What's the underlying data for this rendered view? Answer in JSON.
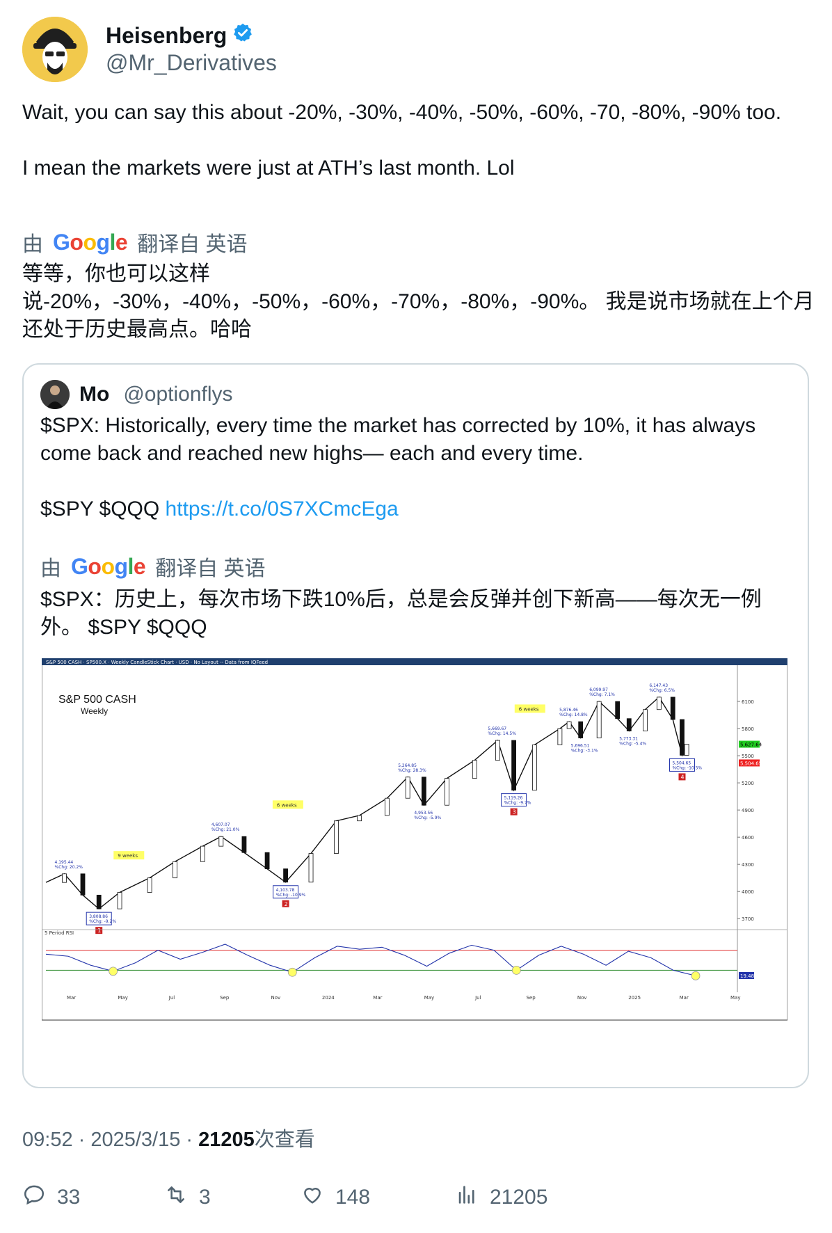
{
  "author": {
    "display_name": "Heisenberg",
    "handle": "@Mr_Derivatives"
  },
  "tweet": {
    "line1": "Wait, you can say this about -20%, -30%, -40%, -50%, -60%, -70, -80%, -90% too.",
    "line2": "I mean the markets were just at ATH’s last month. Lol",
    "translate_prefix": "由",
    "translate_suffix": "翻译自 英语",
    "translated_line1": "等等，你也可以这样",
    "translated_line2": "说-20%，-30%，-40%，-50%，-60%，-70%，-80%，-90%。 我是说市场就在上个月还处于历史最高点。哈哈"
  },
  "quote": {
    "display_name": "Mo",
    "handle": "@optionflys",
    "text": "$SPX: Historically, every time the market has corrected by 10%, it has always come back and reached new highs— each and every time.",
    "tickers": "$SPY $QQQ",
    "link": "https://t.co/0S7XCmcEga",
    "translate_prefix": "由",
    "translate_suffix": "翻译自 英语",
    "translated": "$SPX：历史上，每次市场下跌10%后，总是会反弹并创下新高——每次无一例外。 $SPY $QQQ"
  },
  "chart_data": {
    "type": "line",
    "header": "S&P 500 CASH · SP500.X · Weekly CandleStick Chart · USD · No Layout -- Data from IQFeed",
    "title": "S&P 500 CASH",
    "subtitle": "Weekly",
    "x_labels": [
      "Mar",
      "May",
      "Jul",
      "Sep",
      "Nov",
      "2024",
      "Mar",
      "May",
      "Jul",
      "Sep",
      "Nov",
      "2025",
      "Mar",
      "May"
    ],
    "y_ticks": [
      3700,
      4000,
      4300,
      4600,
      4900,
      5200,
      5500,
      5800,
      6100
    ],
    "ylim": [
      3640,
      6300
    ],
    "price_series": [
      {
        "x": 0,
        "y": 4100
      },
      {
        "x": 0.8,
        "y": 4195
      },
      {
        "x": 1.6,
        "y": 3960
      },
      {
        "x": 2.3,
        "y": 3808
      },
      {
        "x": 3.2,
        "y": 3990
      },
      {
        "x": 4.5,
        "y": 4150
      },
      {
        "x": 5.6,
        "y": 4330
      },
      {
        "x": 6.8,
        "y": 4500
      },
      {
        "x": 7.6,
        "y": 4607
      },
      {
        "x": 8.6,
        "y": 4430
      },
      {
        "x": 9.6,
        "y": 4250
      },
      {
        "x": 10.4,
        "y": 4103
      },
      {
        "x": 11.5,
        "y": 4420
      },
      {
        "x": 12.6,
        "y": 4780
      },
      {
        "x": 13.6,
        "y": 4840
      },
      {
        "x": 14.8,
        "y": 5030
      },
      {
        "x": 15.7,
        "y": 5264
      },
      {
        "x": 16.4,
        "y": 4953
      },
      {
        "x": 17.4,
        "y": 5250
      },
      {
        "x": 18.6,
        "y": 5450
      },
      {
        "x": 19.6,
        "y": 5669
      },
      {
        "x": 20.3,
        "y": 5119
      },
      {
        "x": 21.2,
        "y": 5620
      },
      {
        "x": 22.3,
        "y": 5800
      },
      {
        "x": 22.7,
        "y": 5876
      },
      {
        "x": 23.2,
        "y": 5696
      },
      {
        "x": 24.0,
        "y": 6099
      },
      {
        "x": 24.8,
        "y": 5910
      },
      {
        "x": 25.3,
        "y": 5773
      },
      {
        "x": 26.0,
        "y": 6010
      },
      {
        "x": 26.6,
        "y": 6147
      },
      {
        "x": 27.2,
        "y": 5900
      },
      {
        "x": 27.6,
        "y": 5505
      },
      {
        "x": 27.8,
        "y": 5627
      }
    ],
    "annotations": [
      {
        "x": 0.8,
        "y": 4195,
        "label": "4,195.44",
        "change": "%Chg: 20.2%"
      },
      {
        "x": 2.3,
        "y": 3808,
        "label": "3,808.86",
        "change": "%Chg: -9.2%",
        "num": "1"
      },
      {
        "x": 7.6,
        "y": 4607,
        "label": "4,607.07",
        "change": "%Chg: 21.0%"
      },
      {
        "x": 10.4,
        "y": 4103,
        "label": "4,103.78",
        "change": "%Chg: -10.9%",
        "num": "2"
      },
      {
        "x": 15.7,
        "y": 5264,
        "label": "5,264.85",
        "change": "%Chg: 28.3%"
      },
      {
        "x": 16.4,
        "y": 4953,
        "label": "4,953.56",
        "change": "%Chg: -5.9%"
      },
      {
        "x": 19.6,
        "y": 5669,
        "label": "5,669.67",
        "change": "%Chg: 14.5%"
      },
      {
        "x": 20.3,
        "y": 5119,
        "label": "5,119.26",
        "change": "%Chg: -9.7%",
        "num": "3"
      },
      {
        "x": 22.7,
        "y": 5876,
        "label": "5,876.46",
        "change": "%Chg: 14.8%"
      },
      {
        "x": 23.2,
        "y": 5696,
        "label": "5,696.51",
        "change": "%Chg: -3.1%"
      },
      {
        "x": 24.0,
        "y": 6099,
        "label": "6,099.97",
        "change": "%Chg: 7.1%"
      },
      {
        "x": 25.3,
        "y": 5773,
        "label": "5,773.31",
        "change": "%Chg: -5.4%"
      },
      {
        "x": 26.6,
        "y": 6147,
        "label": "6,147.43",
        "change": "%Chg: 6.5%"
      },
      {
        "x": 27.6,
        "y": 5505,
        "label": "5,504.65",
        "change": "%Chg: -10.5%",
        "num": "4"
      }
    ],
    "week_boxes": [
      "9 weeks",
      "6 weeks",
      "6 weeks"
    ],
    "last_price": "5,627.64",
    "current_label": "5,504.65",
    "rsi_label": "5 Period RSI",
    "rsi_last": "19.48",
    "rsi_levels": [
      70,
      30
    ],
    "rsi_series": [
      62,
      58,
      40,
      28,
      45,
      70,
      52,
      66,
      82,
      60,
      40,
      26,
      55,
      78,
      72,
      76,
      60,
      38,
      64,
      80,
      70,
      30,
      60,
      78,
      62,
      40,
      68,
      55,
      30,
      19
    ]
  },
  "meta": {
    "time": "09:52 · 2025/3/15 · ",
    "views_count": "21205",
    "views_label": "次查看"
  },
  "actions": {
    "replies": "33",
    "reposts": "3",
    "likes": "148",
    "views": "21205"
  }
}
